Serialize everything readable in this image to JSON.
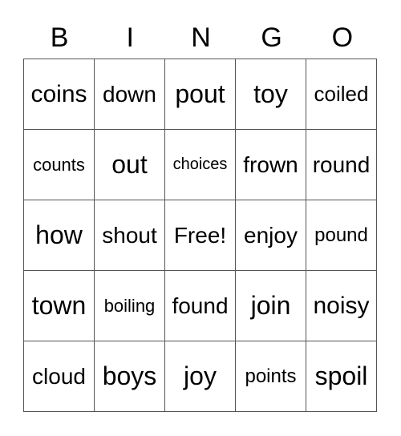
{
  "header": [
    "B",
    "I",
    "N",
    "G",
    "O"
  ],
  "rows": [
    [
      {
        "t": "coins",
        "s": 30
      },
      {
        "t": "down",
        "s": 28
      },
      {
        "t": "pout",
        "s": 32
      },
      {
        "t": "toy",
        "s": 32
      },
      {
        "t": "coiled",
        "s": 26
      }
    ],
    [
      {
        "t": "counts",
        "s": 22
      },
      {
        "t": "out",
        "s": 32
      },
      {
        "t": "choices",
        "s": 20
      },
      {
        "t": "frown",
        "s": 28
      },
      {
        "t": "round",
        "s": 28
      }
    ],
    [
      {
        "t": "how",
        "s": 32
      },
      {
        "t": "shout",
        "s": 28
      },
      {
        "t": "Free!",
        "s": 28
      },
      {
        "t": "enjoy",
        "s": 28
      },
      {
        "t": "pound",
        "s": 24
      }
    ],
    [
      {
        "t": "town",
        "s": 32
      },
      {
        "t": "boiling",
        "s": 22
      },
      {
        "t": "found",
        "s": 28
      },
      {
        "t": "join",
        "s": 32
      },
      {
        "t": "noisy",
        "s": 30
      }
    ],
    [
      {
        "t": "cloud",
        "s": 28
      },
      {
        "t": "boys",
        "s": 32
      },
      {
        "t": "joy",
        "s": 32
      },
      {
        "t": "points",
        "s": 24
      },
      {
        "t": "spoil",
        "s": 32
      }
    ]
  ]
}
